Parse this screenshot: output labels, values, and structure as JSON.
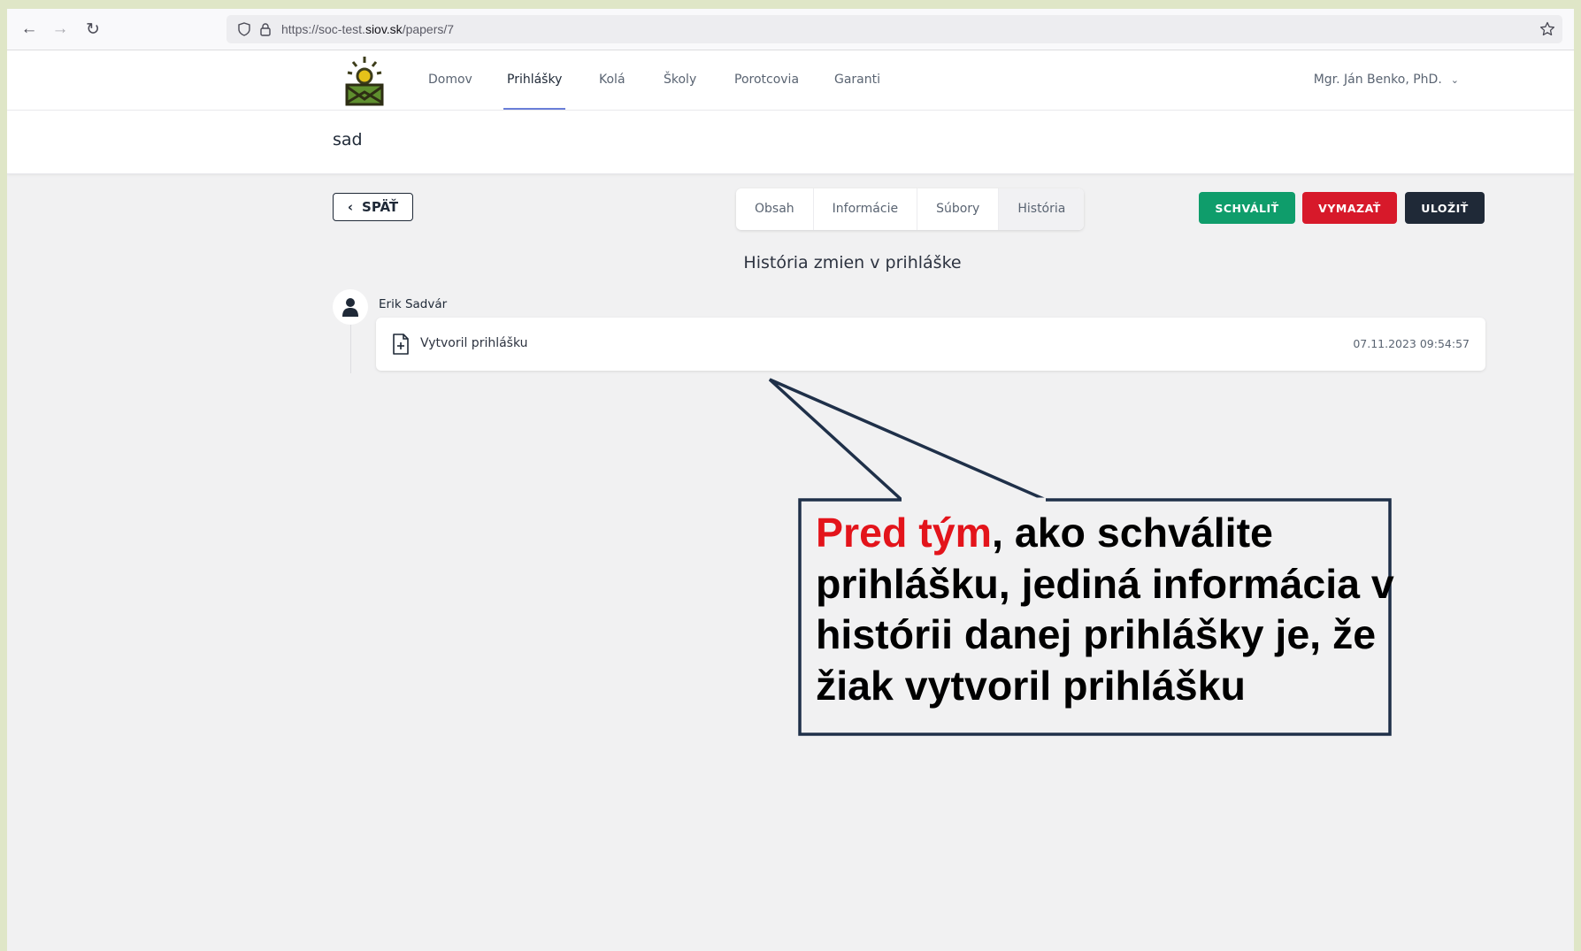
{
  "browser": {
    "url_prefix": "https://soc-test.",
    "url_domain": "siov.sk",
    "url_path": "/papers/7"
  },
  "header": {
    "nav": [
      "Domov",
      "Prihlášky",
      "Kolá",
      "Školy",
      "Porotcovia",
      "Garanti"
    ],
    "active_nav": "Prihlášky",
    "user_name": "Mgr. Ján Benko, PhD."
  },
  "page": {
    "title": "sad"
  },
  "toolbar": {
    "back_label": "SPÄŤ",
    "tabs": [
      "Obsah",
      "Informácie",
      "Súbory",
      "História"
    ],
    "active_tab": "História",
    "approve_label": "SCHVÁLIŤ",
    "delete_label": "VYMAZAŤ",
    "save_label": "ULOŽIŤ",
    "colors": {
      "approve": "#0f9d6b",
      "delete": "#d7192a",
      "save": "#1f2937"
    }
  },
  "history": {
    "title": "História zmien v prihláške",
    "author": "Erik Sadvár",
    "entries": [
      {
        "text": "Vytvoril prihlášku",
        "timestamp": "07.11.2023 09:54:57",
        "icon": "file-plus-icon"
      }
    ]
  },
  "callout": {
    "highlight": "Pred tým",
    "rest": ", ako schválite prihlášku, jediná informácia v histórii danej prihlášky je, že žiak vytvoril prihlášku",
    "colors": {
      "highlight": "#e3141b",
      "border": "#1f3049"
    }
  }
}
